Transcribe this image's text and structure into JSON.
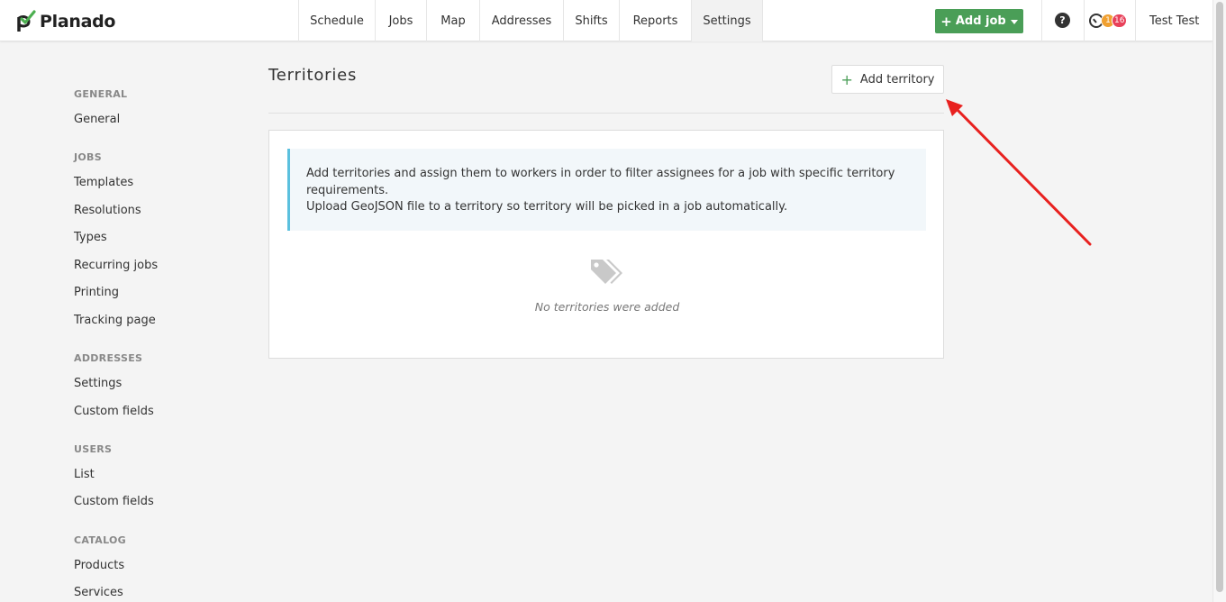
{
  "app": {
    "brand": "Planado"
  },
  "nav": {
    "items": [
      {
        "label": "Schedule",
        "width": 85
      },
      {
        "label": "Jobs",
        "width": 57
      },
      {
        "label": "Map",
        "width": 59
      },
      {
        "label": "Addresses",
        "width": 93
      },
      {
        "label": "Shifts",
        "width": 62
      },
      {
        "label": "Reports",
        "width": 80
      },
      {
        "label": "Settings",
        "width": 79,
        "active": true
      }
    ]
  },
  "header": {
    "add_job_label": "Add job",
    "help_label": "?",
    "badge_orange": "1",
    "badge_red": "16",
    "user_name": "Test Test"
  },
  "sidebar": {
    "sections": [
      {
        "title": "GENERAL",
        "items": [
          "General"
        ]
      },
      {
        "title": "JOBS",
        "items": [
          "Templates",
          "Resolutions",
          "Types",
          "Recurring jobs",
          "Printing",
          "Tracking page"
        ]
      },
      {
        "title": "ADDRESSES",
        "items": [
          "Settings",
          "Custom fields"
        ]
      },
      {
        "title": "USERS",
        "items": [
          "List",
          "Custom fields"
        ]
      },
      {
        "title": "CATALOG",
        "items": [
          "Products",
          "Services"
        ]
      }
    ]
  },
  "main": {
    "title": "Territories",
    "add_button_label": "Add territory",
    "info_line1": "Add territories and assign them to workers in order to filter assignees for a job with specific territory requirements.",
    "info_line2": "Upload GeoJSON file to a territory so territory will be picked in a job automatically.",
    "empty_text": "No territories were added"
  },
  "colors": {
    "accent_green": "#4a9e57",
    "info_border": "#5bc0de",
    "annotation_arrow": "#e8211f"
  }
}
